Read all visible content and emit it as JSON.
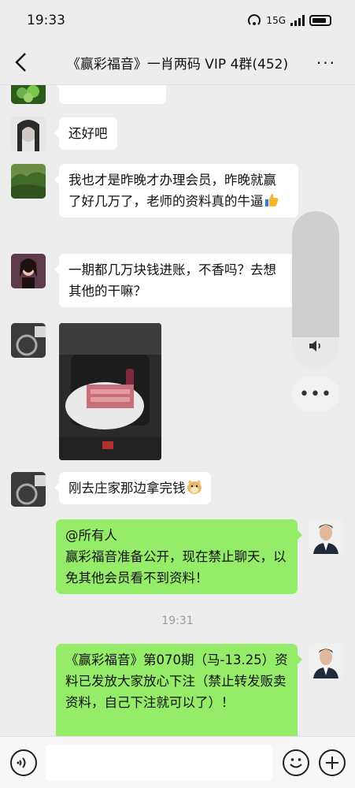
{
  "status_bar": {
    "time": "19:33",
    "network": "5G",
    "network_prefix": "1"
  },
  "header": {
    "title": "《赢彩福音》一肖两码 VIP 4群(452)"
  },
  "messages": [
    {
      "id": "m1",
      "side": "left",
      "text": "还好吧"
    },
    {
      "id": "m2",
      "side": "left",
      "text": "我也才是昨晚才办理会员，昨晚就赢了好几万了，老师的资料真的牛逼"
    },
    {
      "id": "m3",
      "side": "left",
      "text": "一期都几万块钱进账，不香吗？去想其他的干嘛？"
    },
    {
      "id": "m4",
      "side": "left",
      "type": "image",
      "description": "car-seat-cash-bag-photo"
    },
    {
      "id": "m5",
      "side": "left",
      "text": "刚去庄家那边拿完钱"
    },
    {
      "id": "m6",
      "side": "right",
      "mention": "@所有人",
      "text": "赢彩福音准备公开，现在禁止聊天，以免其他会员看不到资料！"
    },
    {
      "id": "m7",
      "side": "right",
      "text": "《赢彩福音》第070期（马-13.25）资料已发放大家放心下注（禁止转发贩卖资料，自己下注就可以了）！"
    }
  ],
  "timestamp": "19:31",
  "input_bar": {
    "placeholder": ""
  },
  "colors": {
    "background": "#ededed",
    "bubble_left": "#ffffff",
    "bubble_right": "#95ec69",
    "timestamp": "#9a9a9a"
  }
}
